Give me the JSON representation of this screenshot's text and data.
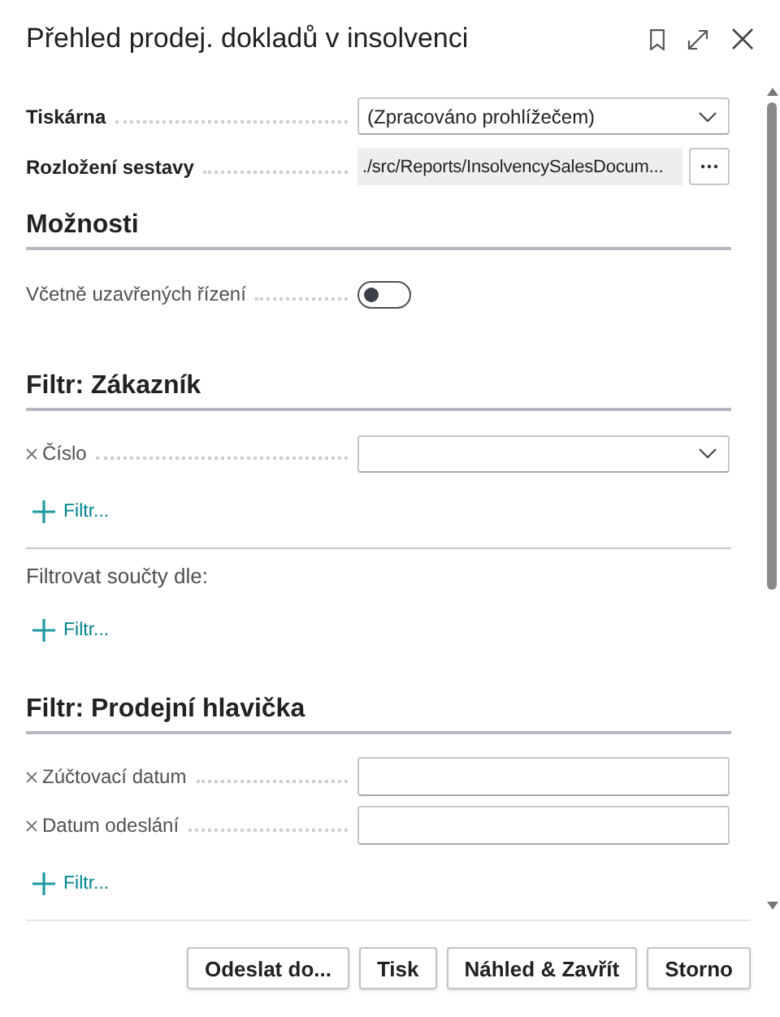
{
  "window": {
    "title": "Přehled prodej. dokladů v insolvenci"
  },
  "report_settings": [
    {
      "label": "Tiskárna",
      "kind": "dropdown",
      "value": "(Zpracováno prohlížečem)"
    },
    {
      "label": "Rozložení sestavy",
      "kind": "lookup",
      "value": "./src/Reports/InsolvencySalesDocum..."
    }
  ],
  "sections": [
    {
      "title": "Možnosti",
      "items": [
        {
          "kind": "toggle",
          "label": "Včetně uzavřených řízení",
          "on": false
        }
      ]
    },
    {
      "title": "Filtr: Zákazník",
      "items": [
        {
          "kind": "filter_dropdown",
          "label": "Číslo"
        },
        {
          "kind": "add_filter",
          "label": "Filtr..."
        },
        {
          "kind": "subheading",
          "label": "Filtrovat součty dle:"
        },
        {
          "kind": "add_filter",
          "label": "Filtr..."
        }
      ]
    },
    {
      "title": "Filtr: Prodejní hlavička",
      "items": [
        {
          "kind": "filter_text",
          "label": "Zúčtovací datum"
        },
        {
          "kind": "filter_text",
          "label": "Datum odeslání"
        },
        {
          "kind": "add_filter",
          "label": "Filtr..."
        }
      ]
    }
  ],
  "buttons": [
    "Odeslat do...",
    "Tisk",
    "Náhled & Zavřít",
    "Storno"
  ]
}
